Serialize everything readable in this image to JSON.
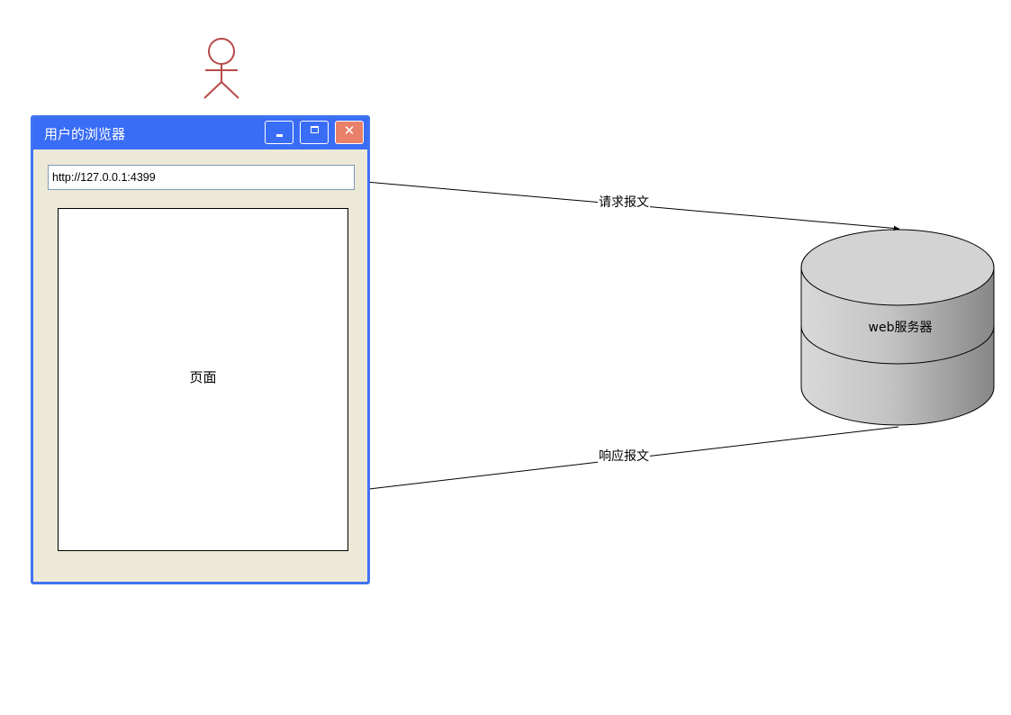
{
  "browser": {
    "title": "用户的浏览器",
    "url": "http://127.0.0.1:4399",
    "page_label": "页面",
    "buttons": {
      "minimize": "minimize-icon",
      "maximize": "maximize-icon",
      "close": "close-icon"
    }
  },
  "server": {
    "label": "web服务器"
  },
  "edges": {
    "request_label": "请求报文",
    "response_label": "响应报文"
  },
  "colors": {
    "titlebar": "#3a6df5",
    "window_border": "#3f73f1",
    "window_body": "#ece9d8",
    "close_button": "#e8806a",
    "actor": "#b84a4a",
    "server_top": "#d3d3d3"
  }
}
